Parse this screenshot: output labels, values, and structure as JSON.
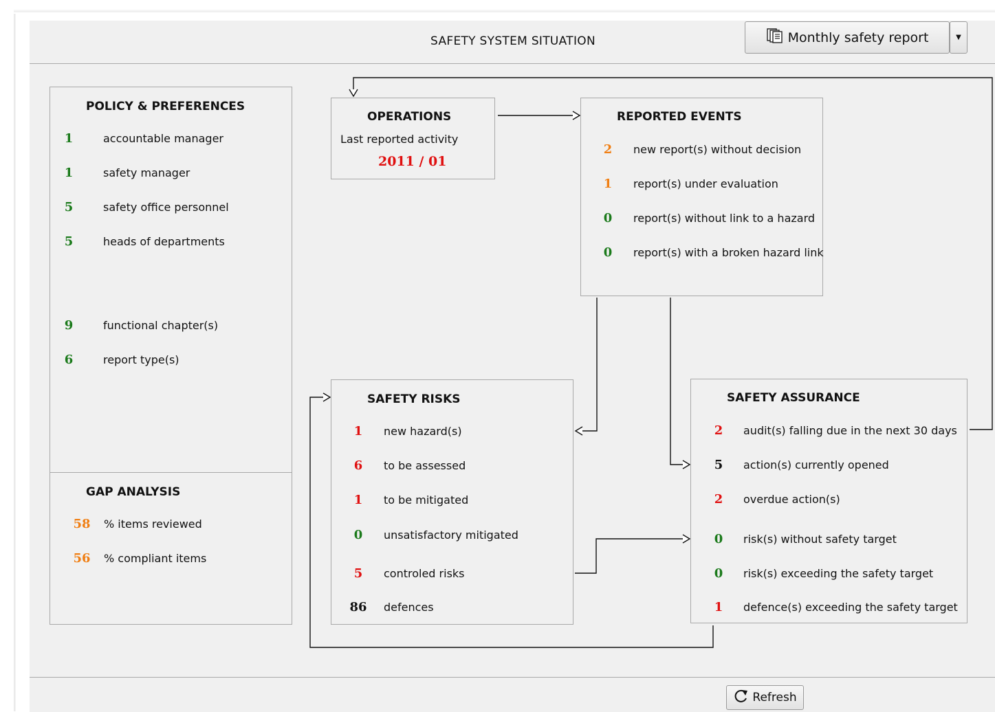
{
  "header": {
    "title": "SAFETY SYSTEM SITUATION",
    "report_button": "Monthly safety report",
    "report_icon": "document-stack-icon",
    "dropdown_icon": "caret-down-icon"
  },
  "policy": {
    "title": "POLICY & PREFERENCES",
    "items": [
      {
        "value": "1",
        "label": "accountable manager",
        "color": "#1b7a1b"
      },
      {
        "value": "1",
        "label": "safety manager",
        "color": "#1b7a1b"
      },
      {
        "value": "5",
        "label": "safety office personnel",
        "color": "#1b7a1b"
      },
      {
        "value": "5",
        "label": "heads of departments",
        "color": "#1b7a1b"
      },
      {
        "value": "9",
        "label": "functional chapter(s)",
        "color": "#1b7a1b"
      },
      {
        "value": "6",
        "label": "report type(s)",
        "color": "#1b7a1b"
      }
    ]
  },
  "gap": {
    "title": "GAP ANALYSIS",
    "items": [
      {
        "value": "58",
        "label": "% items reviewed",
        "color": "#f07f14"
      },
      {
        "value": "56",
        "label": "% compliant items",
        "color": "#f07f14"
      }
    ]
  },
  "operations": {
    "title": "OPERATIONS",
    "subtitle": "Last reported activity",
    "date": "2011 / 01"
  },
  "reported_events": {
    "title": "REPORTED EVENTS",
    "items": [
      {
        "value": "2",
        "label": "new report(s) without decision",
        "color": "#f07f14"
      },
      {
        "value": "1",
        "label": "report(s) under evaluation",
        "color": "#f07f14"
      },
      {
        "value": "0",
        "label": "report(s) without link to a hazard",
        "color": "#1b7a1b"
      },
      {
        "value": "0",
        "label": "report(s) with a broken hazard link",
        "color": "#1b7a1b"
      }
    ]
  },
  "safety_risks": {
    "title": "SAFETY RISKS",
    "items": [
      {
        "value": "1",
        "label": "new hazard(s)",
        "color": "#e01010"
      },
      {
        "value": "6",
        "label": "to be assessed",
        "color": "#e01010"
      },
      {
        "value": "1",
        "label": "to be mitigated",
        "color": "#e01010"
      },
      {
        "value": "0",
        "label": "unsatisfactory mitigated",
        "color": "#1b7a1b"
      },
      {
        "value": "5",
        "label": "controled risks",
        "color": "#e01010"
      },
      {
        "value": "86",
        "label": "defences",
        "color": "#111111"
      }
    ]
  },
  "safety_assurance": {
    "title": "SAFETY ASSURANCE",
    "items": [
      {
        "value": "2",
        "label": "audit(s) falling due in the next 30 days",
        "color": "#e01010"
      },
      {
        "value": "5",
        "label": "action(s) currently opened",
        "color": "#111111"
      },
      {
        "value": "2",
        "label": "overdue action(s)",
        "color": "#e01010"
      },
      {
        "value": "0",
        "label": "risk(s)  without safety target",
        "color": "#1b7a1b"
      },
      {
        "value": "0",
        "label": "risk(s) exceeding the safety target",
        "color": "#1b7a1b"
      },
      {
        "value": "1",
        "label": "defence(s) exceeding the safety target",
        "color": "#e01010"
      }
    ]
  },
  "footer": {
    "refresh_label": "Refresh",
    "refresh_icon": "refresh-icon"
  }
}
